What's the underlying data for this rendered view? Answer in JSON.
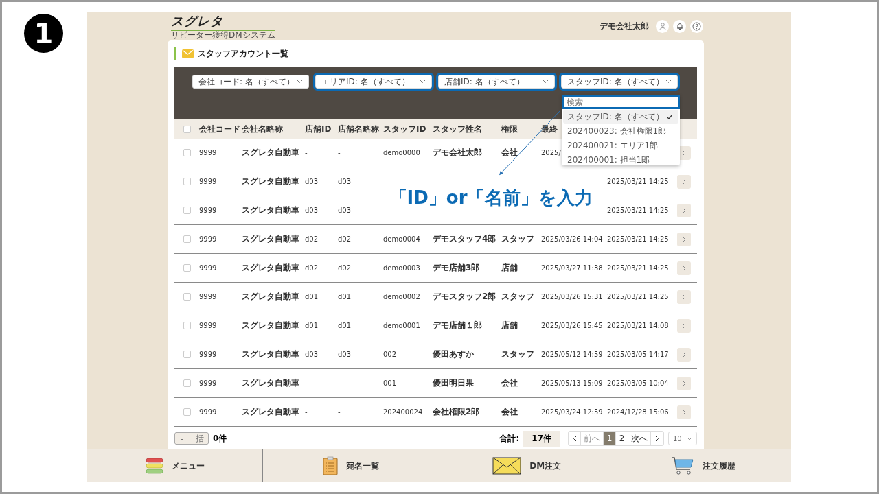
{
  "step_number": "1",
  "header": {
    "logo": "スグレタ",
    "logo_subtitle": "リピーター獲得DMシステム",
    "user_name": "デモ会社太郎"
  },
  "page_title": "スタッフアカウント一覧",
  "filters": [
    {
      "label": "会社コード: 名（すべて）",
      "highlighted": false
    },
    {
      "label": "エリアID: 名（すべて）",
      "highlighted": true
    },
    {
      "label": "店舗ID: 名（すべて）",
      "highlighted": true
    },
    {
      "label": "スタッフID: 名（すべて）",
      "highlighted": true
    }
  ],
  "dropdown": {
    "search": {
      "placeholder": "検索",
      "highlighted": true
    },
    "options": [
      {
        "label": "スタッフID: 名（すべて）",
        "selected": true
      },
      {
        "label": "202400023: 会社権限1郎",
        "selected": false
      },
      {
        "label": "202400021: エリア1郎",
        "selected": false
      },
      {
        "label": "202400001: 担当1郎",
        "selected": false
      }
    ]
  },
  "table": {
    "select_all_checked": false,
    "columns": [
      "会社コード",
      "会社名略称",
      "店舗ID",
      "店舗名略称",
      "スタッフID",
      "スタッフ性名",
      "権限",
      "最終",
      null
    ],
    "rows": [
      {
        "checked": false,
        "cells": [
          "9999",
          "スグレタ自動車",
          "-",
          "-",
          "demo0000",
          "デモ会社太郎",
          "会社",
          "2025/",
          null
        ]
      },
      {
        "checked": false,
        "cells": [
          "9999",
          "スグレタ自動車",
          "d03",
          "d03",
          null,
          null,
          null,
          null,
          "2025/03/21 14:25"
        ]
      },
      {
        "checked": false,
        "cells": [
          "9999",
          "スグレタ自動車",
          "d03",
          "d03",
          null,
          null,
          null,
          null,
          "2025/03/21 14:25"
        ]
      },
      {
        "checked": false,
        "cells": [
          "9999",
          "スグレタ自動車",
          "d02",
          "d02",
          "demo0004",
          "デモスタッフ4郎",
          "スタッフ",
          "2025/03/26 14:04",
          "2025/03/21 14:25"
        ]
      },
      {
        "checked": false,
        "cells": [
          "9999",
          "スグレタ自動車",
          "d02",
          "d02",
          "demo0003",
          "デモ店舗3郎",
          "店舗",
          "2025/03/27 11:38",
          "2025/03/21 14:25"
        ]
      },
      {
        "checked": false,
        "cells": [
          "9999",
          "スグレタ自動車",
          "d01",
          "d01",
          "demo0002",
          "デモスタッフ2郎",
          "スタッフ",
          "2025/03/26 15:31",
          "2025/03/21 14:25"
        ]
      },
      {
        "checked": false,
        "cells": [
          "9999",
          "スグレタ自動車",
          "d01",
          "d01",
          "demo0001",
          "デモ店舗１郎",
          "店舗",
          "2025/03/26 15:45",
          "2025/03/21 14:08"
        ]
      },
      {
        "checked": false,
        "cells": [
          "9999",
          "スグレタ自動車",
          "d03",
          "d03",
          "002",
          "優田あすか",
          "スタッフ",
          "2025/05/12 14:59",
          "2025/03/05 14:17"
        ]
      },
      {
        "checked": false,
        "cells": [
          "9999",
          "スグレタ自動車",
          "-",
          "-",
          "001",
          "優田明日果",
          "会社",
          "2025/05/13 15:09",
          "2025/03/05 10:04"
        ]
      },
      {
        "checked": false,
        "cells": [
          "9999",
          "スグレタ自動車",
          "-",
          "-",
          "202400024",
          "会社権限2郎",
          "会社",
          "2025/03/24 12:59",
          "2024/12/28 15:06"
        ]
      }
    ]
  },
  "footer": {
    "bulk_button": "一括",
    "selected_count": "0件",
    "total_label": "合計:",
    "total_value": "17件",
    "prev": "前へ",
    "next": "次へ",
    "pages": [
      {
        "label": "1",
        "selected": true
      },
      {
        "label": "2",
        "selected": false
      }
    ],
    "per_page": "10"
  },
  "callout": "「ID」or「名前」を入力",
  "bottom_nav": [
    {
      "kind": "menu",
      "label": "メニュー"
    },
    {
      "kind": "clipboard",
      "label": "宛名一覧"
    },
    {
      "kind": "envelope",
      "label": "DM注文"
    },
    {
      "kind": "cart",
      "label": "注文履歴"
    }
  ]
}
